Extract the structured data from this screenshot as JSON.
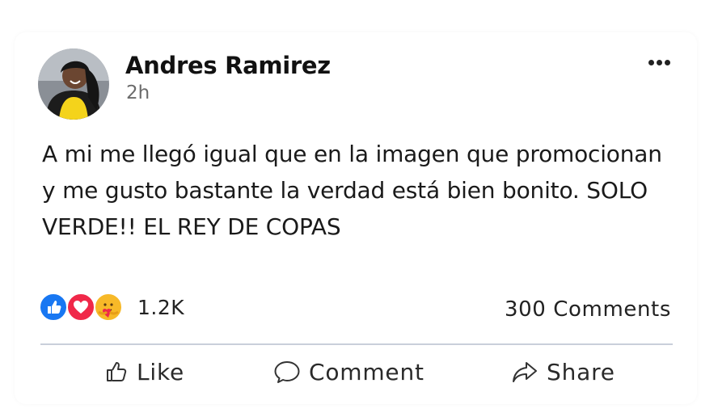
{
  "post": {
    "author": "Andres Ramirez",
    "time": "2h",
    "text": "A mi me llegó igual que en la imagen que promocionan y me gusto bastante la verdad está bien bonito. SOLO VERDE!! EL REY DE COPAS",
    "reactions": {
      "icons": [
        "like-icon",
        "love-icon",
        "care-icon"
      ],
      "count": "1.2K"
    },
    "comments_count": "300 Comments"
  },
  "actions": {
    "like_label": "Like",
    "comment_label": "Comment",
    "share_label": "Share"
  },
  "colors": {
    "like_blue": "#1877f2",
    "love_red": "#f02849",
    "care_yellow": "#f7b928",
    "divider": "#c9cfda"
  }
}
